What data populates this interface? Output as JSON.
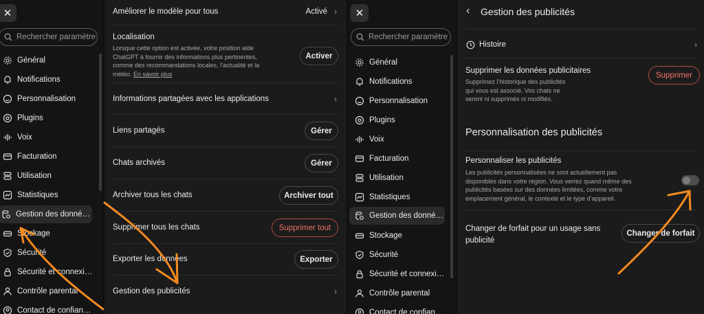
{
  "left_sidebar": {
    "search_placeholder": "Rechercher paramètre",
    "items": [
      "Général",
      "Notifications",
      "Personnalisation",
      "Plugins",
      "Voix",
      "Facturation",
      "Utilisation",
      "Statistiques",
      "Gestion des donné…",
      "Stockage",
      "Sécurité",
      "Sécurité et connexi…",
      "Contrôle parental",
      "Contact de confian…"
    ]
  },
  "data_controls": {
    "improve_model": {
      "label": "Améliorer le modèle pour tous",
      "value": "Activé"
    },
    "location": {
      "label": "Localisation",
      "desc1": "Lorsque cette option est activée, votre position aide",
      "desc2": "ChatGPT à fournir des informations plus pertinentes,",
      "desc3": "comme des recommandations locales, l’actualité et la",
      "desc4": "météo.",
      "link": "En savoir plus",
      "button": "Activer"
    },
    "shared_apps": "Informations partagées avec les applications",
    "shared_links": {
      "label": "Liens partagés",
      "button": "Gérer"
    },
    "archived": {
      "label": "Chats archivés",
      "button": "Gérer"
    },
    "archive_all": {
      "label": "Archiver tous les chats",
      "button": "Archiver tout"
    },
    "delete_all": {
      "label": "Supprimer tous les chats",
      "button": "Supprimer tout"
    },
    "export": {
      "label": "Exporter les données",
      "button": "Exporter"
    },
    "ads": "Gestion des publicités"
  },
  "right_sidebar": {
    "search_placeholder": "Rechercher paramètre",
    "items": [
      "Général",
      "Notifications",
      "Personnalisation",
      "Plugins",
      "Voix",
      "Facturation",
      "Utilisation",
      "Statistiques",
      "Gestion des donné…",
      "Stockage",
      "Sécurité",
      "Sécurité et connexi…",
      "Contrôle parental",
      "Contact de confian…"
    ]
  },
  "ads_page": {
    "title": "Gestion des publicités",
    "history": "Histoire",
    "delete_data": {
      "label": "Supprimer les données publicitaires",
      "desc1": "Supprimez l’historique des publicités",
      "desc2": "qui vous est associé. Vos chats ne",
      "desc3": "seront ni supprimés ni modifiés.",
      "button": "Supprimer"
    },
    "section_title": "Personnalisation des publicités",
    "personalize": {
      "label": "Personnaliser les publicités",
      "desc1": "Les publicités personnalisées ne sont actuellement pas",
      "desc2": "disponibles dans votre région. Vous verrez quand même des",
      "desc3": "publicités basées sur des données limitées, comme votre",
      "desc4": "emplacement général, le contexte et le type d’appareil.",
      "enabled": false
    },
    "change_plan": {
      "label1": "Changer de forfait pour un usage sans",
      "label2": "publicité",
      "button": "Changer de forfait"
    }
  },
  "colors": {
    "accent_arrow": "#f58a1f",
    "danger": "#f27267"
  }
}
